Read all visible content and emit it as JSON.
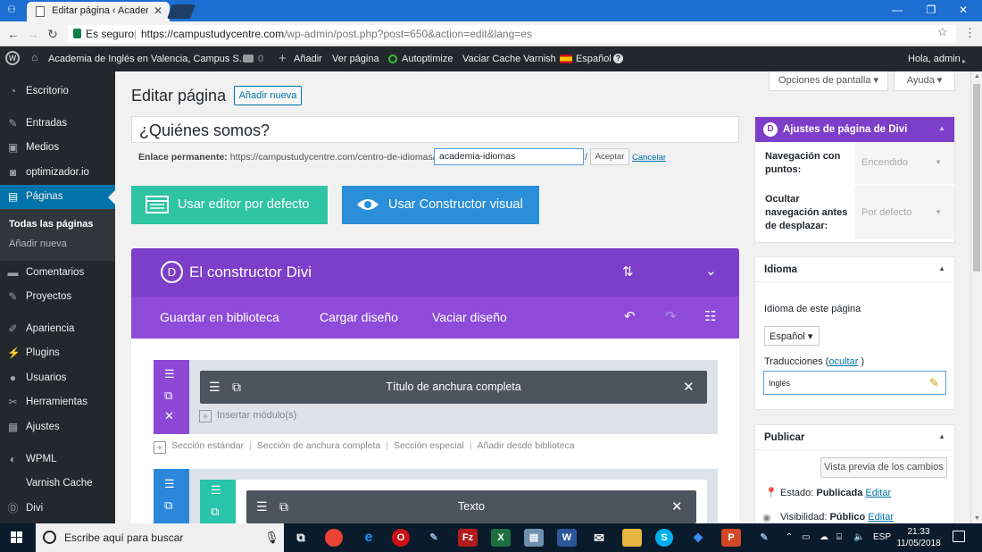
{
  "browser": {
    "tab_title": "Editar página ‹ Academia",
    "secure_label": "Es seguro",
    "url_host": "https://campustudycentre.com",
    "url_path": "/wp-admin/post.php?post=650&action=edit&lang=es"
  },
  "adminbar": {
    "site_name": "Academia de Inglés en Valencia, Campus S...",
    "comments_count": "0",
    "new_label": "Añadir",
    "view_page": "Ver página",
    "autoptimize": "Autoptimize",
    "varnish": "Vaciar Cache Varnish",
    "language": "Español",
    "greeting": "Hola, admin"
  },
  "sidebar": {
    "items": [
      {
        "label": "Escritorio",
        "icon": "dashboard-icon"
      },
      {
        "label": "Entradas",
        "icon": "pin-icon"
      },
      {
        "label": "Medios",
        "icon": "media-icon"
      },
      {
        "label": "optimizador.io",
        "icon": "optimizer-icon"
      },
      {
        "label": "Páginas",
        "icon": "pages-icon"
      },
      {
        "label": "Comentarios",
        "icon": "comments-icon"
      },
      {
        "label": "Proyectos",
        "icon": "pin-icon"
      },
      {
        "label": "Apariencia",
        "icon": "brush-icon"
      },
      {
        "label": "Plugins",
        "icon": "plugin-icon"
      },
      {
        "label": "Usuarios",
        "icon": "user-icon"
      },
      {
        "label": "Herramientas",
        "icon": "wrench-icon"
      },
      {
        "label": "Ajustes",
        "icon": "settings-icon"
      },
      {
        "label": "WPML",
        "icon": "wpml-icon"
      },
      {
        "label": "Varnish Cache",
        "icon": ""
      },
      {
        "label": "Divi",
        "icon": "divi-icon"
      }
    ],
    "submenu": [
      "Todas las páginas",
      "Añadir nueva"
    ]
  },
  "main": {
    "screen_options": "Opciones de pantalla",
    "help": "Ayuda",
    "heading": "Editar página",
    "add_new": "Añadir nueva",
    "title_value": "¿Quiénes somos?",
    "permalink_label": "Enlace permanente:",
    "permalink_base": "https://campustudycentre.com/centro-de-idiomas/",
    "slug_value": "academia-idiomas",
    "slug_suffix": "/",
    "accept": "Aceptar",
    "cancel": "Cancelar",
    "default_editor": "Usar editor por defecto",
    "visual_builder": "Usar Constructor visual"
  },
  "divi": {
    "title": "El constructor Divi",
    "save_library": "Guardar en biblioteca",
    "load_layout": "Cargar diseño",
    "clear_layout": "Vaciar diseño",
    "module_1": "Título de anchura completa",
    "insert_module": "Insertar módulo(s)",
    "section_links": [
      "Sección estándar",
      "Sección de anchura completa",
      "Sección especial",
      "Añadir desde biblioteca"
    ],
    "module_2": "Texto",
    "colors": {
      "purple": "#7d3ec9",
      "teal": "#2ec4a4",
      "blue": "#2a8fd8"
    }
  },
  "divi_settings": {
    "title": "Ajustes de página de Divi",
    "dot_nav_label": "Navegación con puntos:",
    "dot_nav_value": "Encendido",
    "hide_nav_label": "Ocultar navegación antes de desplazar:",
    "hide_nav_value": "Por defecto"
  },
  "language_box": {
    "title": "Idioma",
    "page_language_label": "Idioma de este página",
    "selected_language": "Español",
    "translations_label": "Traducciones",
    "hide_link": "ocultar",
    "translation_value": "Inglés"
  },
  "publish_box": {
    "title": "Publicar",
    "preview_button": "Vista previa de los cambios",
    "status_label": "Estado:",
    "status_value": "Publicada",
    "visibility_label": "Visibilidad:",
    "visibility_value": "Público",
    "edit": "Editar"
  },
  "taskbar": {
    "search_placeholder": "Escribe aquí para buscar",
    "language": "ESP",
    "time": "21:33",
    "date": "11/05/2018"
  }
}
